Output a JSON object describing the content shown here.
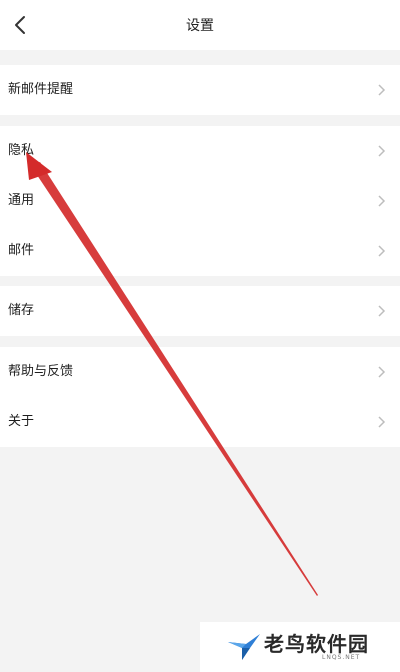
{
  "header": {
    "title": "设置",
    "back_icon": "chevron-left-icon"
  },
  "groups": [
    {
      "items": [
        {
          "label": "新邮件提醒"
        }
      ]
    },
    {
      "items": [
        {
          "label": "隐私"
        },
        {
          "label": "通用"
        },
        {
          "label": "邮件"
        }
      ]
    },
    {
      "items": [
        {
          "label": "储存"
        }
      ]
    },
    {
      "items": [
        {
          "label": "帮助与反馈"
        },
        {
          "label": "关于"
        }
      ]
    }
  ],
  "annotation": {
    "type": "red-arrow",
    "color": "#d42b2b",
    "points_to": "隐私"
  },
  "watermark": {
    "text": "老鸟软件园",
    "subtext": "LNQS.NET"
  },
  "colors": {
    "background": "#f3f3f3",
    "surface": "#ffffff",
    "chevron": "#bdbdbd",
    "arrow": "#d42b2b"
  }
}
